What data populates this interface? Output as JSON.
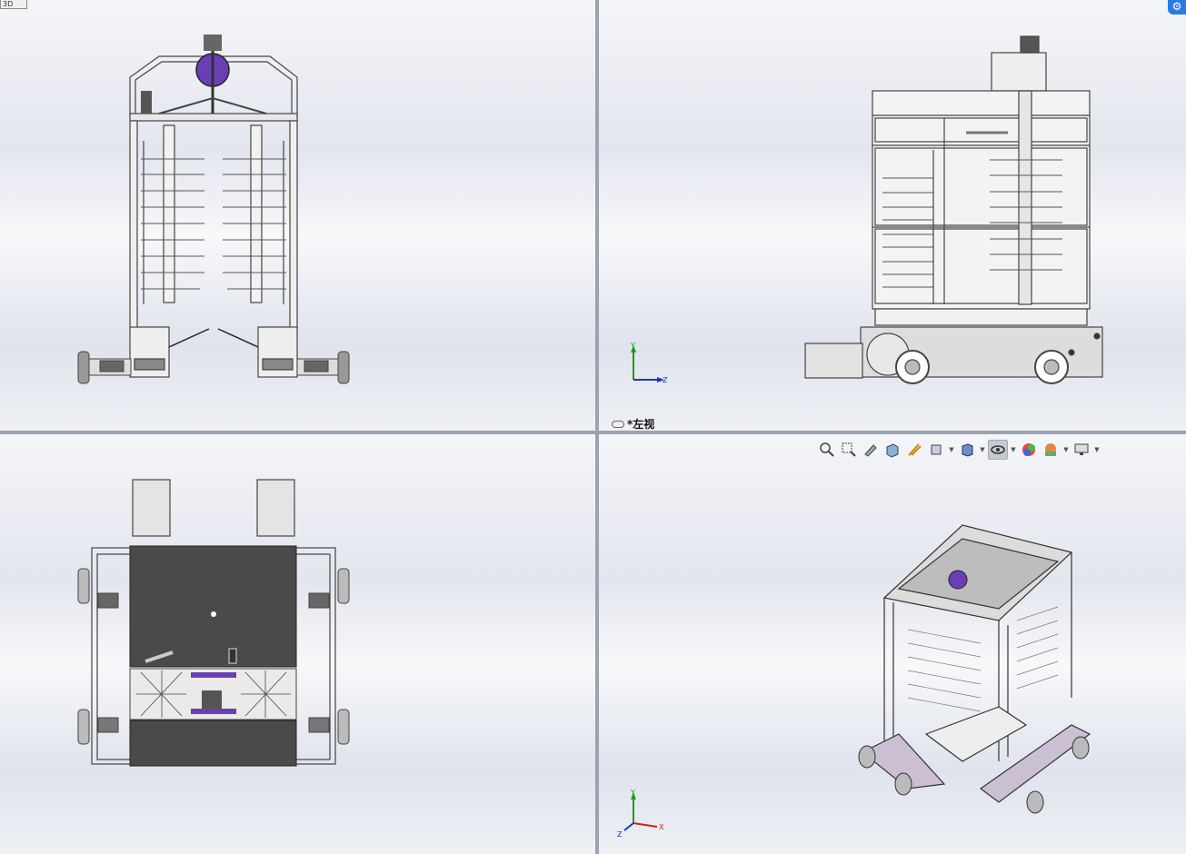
{
  "viewports": {
    "top_left": {
      "tag": "3D"
    },
    "top_right": {
      "view_label": "*左视",
      "triad": {
        "y": "Y",
        "z": "Z"
      }
    },
    "bottom_right": {
      "triad": {
        "y": "Y",
        "x": "X",
        "z": "Z"
      }
    }
  },
  "toolbar": {
    "items": [
      "zoom-to-fit-icon",
      "zoom-area-icon",
      "previous-view-icon",
      "section-view-icon",
      "dynamic-annotation-icon",
      "view-orientation-icon",
      "display-style-icon",
      "hide-show-items-icon",
      "edit-appearance-icon",
      "apply-scene-icon",
      "view-settings-icon"
    ]
  },
  "colors": {
    "accent_purple": "#6a3fb5",
    "frame_gray": "#5a5a5a",
    "panel_dark": "#4a4a4a",
    "axis_x": "#d42020",
    "axis_y": "#1e9a1e",
    "axis_z": "#2030d0"
  }
}
